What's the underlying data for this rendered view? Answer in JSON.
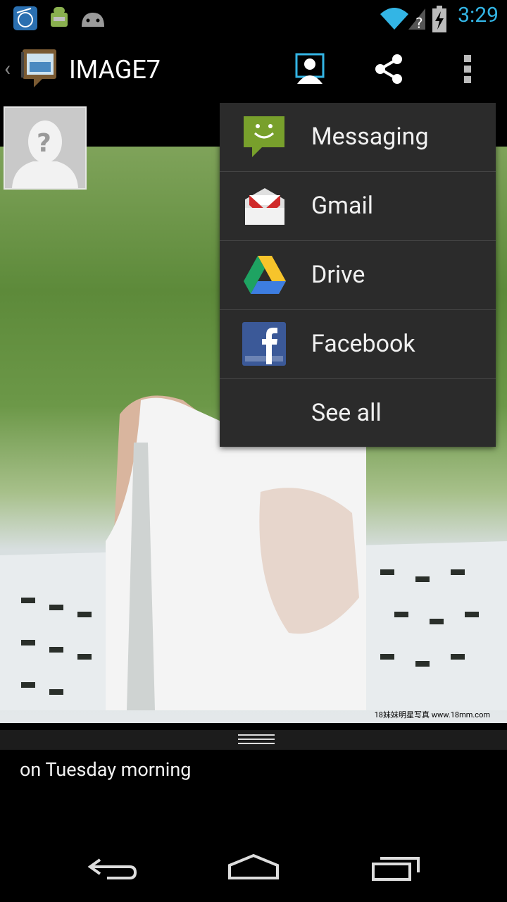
{
  "status_bar": {
    "time": "3:29",
    "icons": [
      "intel-app-icon",
      "android-debug-icon",
      "android-icon",
      "wifi-icon",
      "signal-unknown-icon",
      "battery-charging-icon"
    ]
  },
  "action_bar": {
    "title": "IMAGE7",
    "icons": [
      "up-caret-icon",
      "app-gallery-icon",
      "contact-icon",
      "share-icon",
      "overflow-menu-icon"
    ]
  },
  "photo": {
    "watermark": "18妹妹明星写真 www.18mm.com"
  },
  "share_menu": {
    "items": [
      {
        "label": "Messaging",
        "icon": "messaging-icon"
      },
      {
        "label": "Gmail",
        "icon": "gmail-icon"
      },
      {
        "label": "Drive",
        "icon": "drive-icon"
      },
      {
        "label": "Facebook",
        "icon": "facebook-icon"
      },
      {
        "label": "See all",
        "icon": ""
      }
    ]
  },
  "comment": {
    "text": "on Tuesday morning"
  },
  "colors": {
    "accent": "#33b5e5",
    "menu_bg": "#2b2b2b",
    "divider": "#454545"
  }
}
